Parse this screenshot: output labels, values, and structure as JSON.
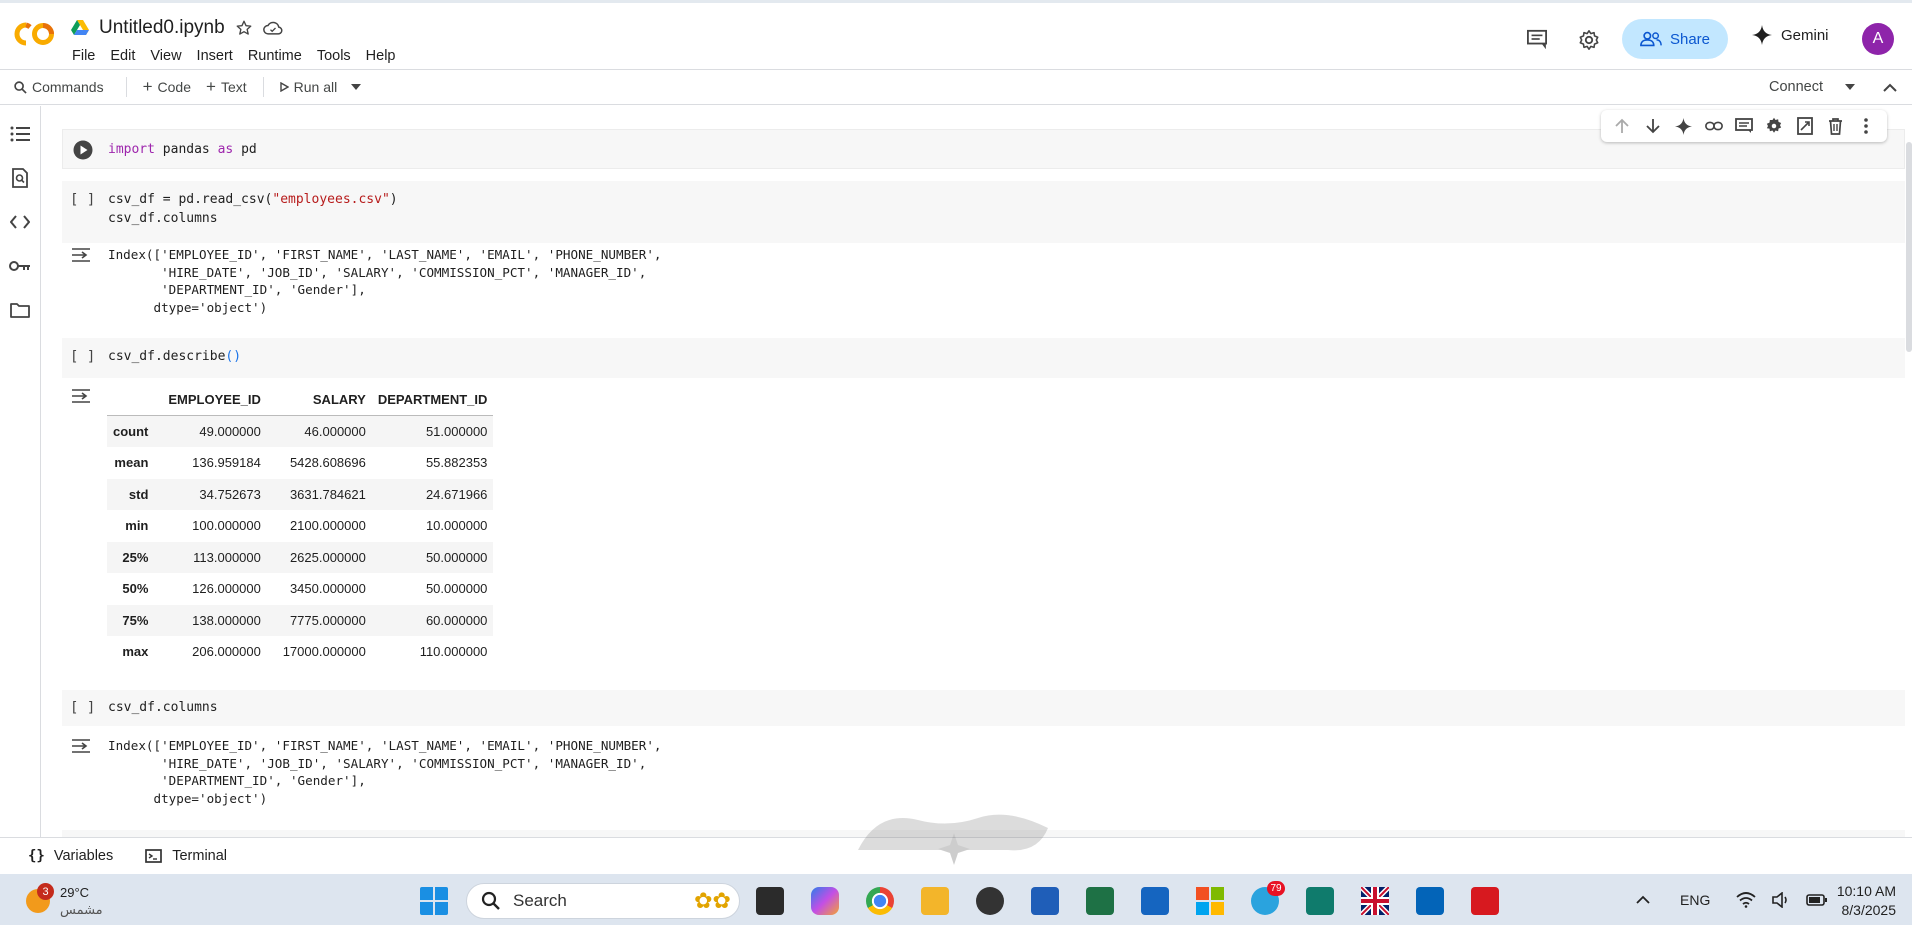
{
  "header": {
    "doc_title": "Untitled0.ipynb",
    "menu": [
      "File",
      "Edit",
      "View",
      "Insert",
      "Runtime",
      "Tools",
      "Help"
    ],
    "share_label": "Share",
    "gemini_label": "Gemini",
    "avatar_letter": "A"
  },
  "toolbar": {
    "commands_label": "Commands",
    "code_label": "Code",
    "text_label": "Text",
    "run_all_label": "Run all",
    "connect_label": "Connect"
  },
  "cells": {
    "cell1": {
      "line1_kw1": "import",
      "line1_mid": " pandas ",
      "line1_kw2": "as",
      "line1_end": " pd"
    },
    "cell2": {
      "bracket": "[ ]",
      "line1_a": "csv_df = pd.read_csv(",
      "line1_str": "\"employees.csv\"",
      "line1_b": ")",
      "line2": "csv_df.columns",
      "output": "Index(['EMPLOYEE_ID', 'FIRST_NAME', 'LAST_NAME', 'EMAIL', 'PHONE_NUMBER',\n       'HIRE_DATE', 'JOB_ID', 'SALARY', 'COMMISSION_PCT', 'MANAGER_ID',\n       'DEPARTMENT_ID', 'Gender'],\n      dtype='object')"
    },
    "cell3": {
      "bracket": "[ ]",
      "line1_a": "csv_df.describe",
      "line1_paren": "()",
      "table": {
        "columns": [
          "EMPLOYEE_ID",
          "SALARY",
          "DEPARTMENT_ID"
        ],
        "rows": [
          {
            "label": "count",
            "values": [
              "49.000000",
              "46.000000",
              "51.000000"
            ]
          },
          {
            "label": "mean",
            "values": [
              "136.959184",
              "5428.608696",
              "55.882353"
            ]
          },
          {
            "label": "std",
            "values": [
              "34.752673",
              "3631.784621",
              "24.671966"
            ]
          },
          {
            "label": "min",
            "values": [
              "100.000000",
              "2100.000000",
              "10.000000"
            ]
          },
          {
            "label": "25%",
            "values": [
              "113.000000",
              "2625.000000",
              "50.000000"
            ]
          },
          {
            "label": "50%",
            "values": [
              "126.000000",
              "3450.000000",
              "50.000000"
            ]
          },
          {
            "label": "75%",
            "values": [
              "138.000000",
              "7775.000000",
              "60.000000"
            ]
          },
          {
            "label": "max",
            "values": [
              "206.000000",
              "17000.000000",
              "110.000000"
            ]
          }
        ]
      }
    },
    "cell4": {
      "bracket": "[ ]",
      "line1": "csv_df.columns",
      "output": "Index(['EMPLOYEE_ID', 'FIRST_NAME', 'LAST_NAME', 'EMAIL', 'PHONE_NUMBER',\n       'HIRE_DATE', 'JOB_ID', 'SALARY', 'COMMISSION_PCT', 'MANAGER_ID',\n       'DEPARTMENT_ID', 'Gender'],\n      dtype='object')"
    }
  },
  "statusbar": {
    "variables_label": "Variables",
    "terminal_label": "Terminal"
  },
  "taskbar": {
    "weather_badge": "3",
    "temperature": "29°C",
    "weather_desc": "مشمس",
    "search_placeholder": "Search",
    "telegram_badge": "79",
    "language": "ENG",
    "time": "10:10 AM",
    "date": "8/3/2025"
  },
  "colors": {
    "share_bg": "#c2e7ff",
    "share_text": "#0b57d0",
    "avatar_bg": "#8e24aa",
    "keyword": "#9e26ad",
    "string": "#b71c1c",
    "taskbar_bg": "#dde5ef"
  }
}
